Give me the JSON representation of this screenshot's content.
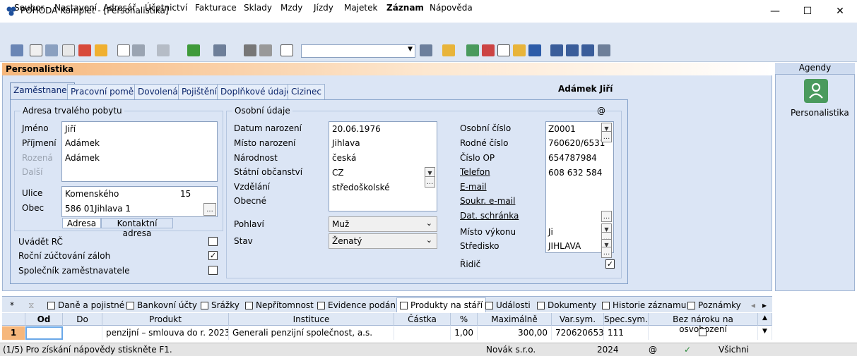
{
  "window": {
    "title": "POHODA Komplet - [Personalistika]",
    "minimize": "—",
    "maximize": "☐",
    "close": "✕"
  },
  "menu": [
    "Soubor",
    "Nastavení",
    "Adresář",
    "Účetnictví",
    "Fakturace",
    "Sklady",
    "Mzdy",
    "Jízdy",
    "Majetek",
    "Záznam",
    "Nápověda"
  ],
  "agenda": {
    "title": "Personalistika",
    "employee": "Adámek Jiří"
  },
  "tabs": [
    "Zaměstnanec",
    "Pracovní poměr",
    "Dovolená",
    "Pojištění",
    "Doplňkové údaje",
    "Cizinec"
  ],
  "address": {
    "group": "Adresa trvalého pobytu",
    "jmeno_label": "Jméno",
    "jmeno": "Jiří",
    "prijmeni_label": "Příjmení",
    "prijmeni": "Adámek",
    "rozena_label": "Rozená",
    "dalsi_label": "Další",
    "ulice_label": "Ulice",
    "ulice": "Komenského",
    "cislo": "15",
    "obec_label": "Obec",
    "psc": "586 01",
    "obec": "Jihlava 1",
    "subtab1": "Adresa",
    "subtab2": "Kontaktní adresa",
    "browse": "..."
  },
  "checks": {
    "uvadet_rc": "Uvádět RČ",
    "rocni": "Roční zúčtování záloh",
    "spolecnik": "Společník zaměstnavatele",
    "ridic": "Řidič",
    "checkmark": "✓"
  },
  "personal": {
    "group": "Osobní údaje",
    "at": "@",
    "datum_label": "Datum narození",
    "datum": "20.06.1976",
    "misto_label": "Místo narození",
    "misto": "Jihlava",
    "narodnost_label": "Národnost",
    "narodnost": "česká",
    "obcanstvi_label": "Státní občanství",
    "obcanstvi": "CZ",
    "vzdelani_label": "Vzdělání",
    "vzdelani": "středoškolské",
    "obecne_label": "Obecné",
    "pohlavi_label": "Pohlaví",
    "pohlavi": "Muž",
    "stav_label": "Stav",
    "stav": "Ženatý"
  },
  "ident": {
    "osobni_label": "Osobní číslo",
    "osobni": "Z0001",
    "rodne_label": "Rodné číslo",
    "rodne": "760620/6531",
    "op_label": "Číslo OP",
    "op": "654787984",
    "telefon_label": "Telefon",
    "telefon": "608 632 584",
    "email_label": "E-mail",
    "semail_label": "Soukr. e-mail",
    "schranka_label": "Dat. schránka",
    "misto_label": "Místo výkonu",
    "misto": "Ji",
    "stredisko_label": "Středisko",
    "stredisko": "JIHLAVA"
  },
  "side": {
    "title": "Agendy",
    "item": "Personalistika"
  },
  "bottom_tabs": [
    "*",
    "Daně a pojistné",
    "Bankovní účty",
    "Srážky",
    "Nepřítomnost",
    "Evidence podání",
    "Produkty na stáří",
    "Události",
    "Dokumenty",
    "Historie záznamu",
    "Poznámky"
  ],
  "grid": {
    "columns": [
      "Od",
      "Do",
      "Produkt",
      "Instituce",
      "Částka",
      "%",
      "Maximálně",
      "Var.sym.",
      "Spec.sym.",
      "Bez nároku na osvobození"
    ],
    "row": {
      "num": "1",
      "od": "",
      "do": "",
      "produkt": "penzijní – smlouva do r. 2023",
      "instituce": "Generali penzijní společnost, a.s.",
      "castka": "",
      "pct": "1,00",
      "max": "300,00",
      "var": "7206206535",
      "spec": "111"
    }
  },
  "status": {
    "help": "(1/5) Pro získání nápovědy stiskněte F1.",
    "company": "Novák s.r.o.",
    "year": "2024",
    "at": "@",
    "filter": "Všichni"
  },
  "colors": {
    "accent": "#f6b77c",
    "panel": "#dbe5f5",
    "agenda_icon": "#4a9a5d"
  }
}
